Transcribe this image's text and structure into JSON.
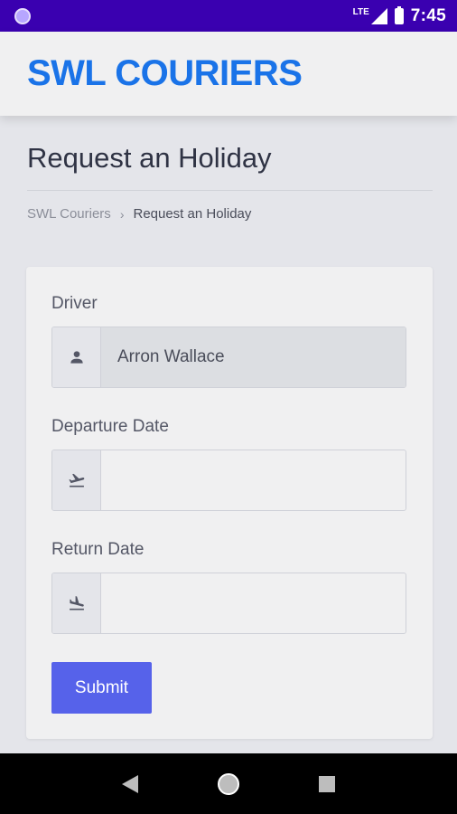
{
  "status_bar": {
    "network": "LTE",
    "time": "7:45"
  },
  "header": {
    "brand": "SWL COURIERS"
  },
  "page": {
    "title": "Request an Holiday",
    "breadcrumb": {
      "home": "SWL Couriers",
      "separator": "›",
      "current": "Request an Holiday"
    }
  },
  "form": {
    "driver": {
      "label": "Driver",
      "value": "Arron Wallace",
      "icon": "person-icon"
    },
    "departure": {
      "label": "Departure Date",
      "value": "",
      "icon": "flight-takeoff-icon"
    },
    "return": {
      "label": "Return Date",
      "value": "",
      "icon": "flight-land-icon"
    },
    "submit_label": "Submit"
  },
  "colors": {
    "status_bar": "#3a00b0",
    "brand": "#1a73e8",
    "button": "#5662ea",
    "background": "#e4e5ea"
  }
}
